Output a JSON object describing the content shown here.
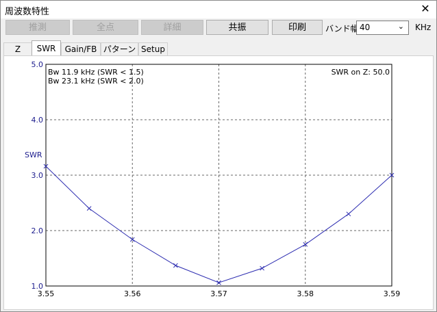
{
  "window": {
    "title": "周波数特性"
  },
  "toolbar": {
    "buttons": [
      {
        "label": "推測",
        "enabled": false
      },
      {
        "label": "全点",
        "enabled": false
      },
      {
        "label": "詳細",
        "enabled": false
      },
      {
        "label": "共振",
        "enabled": true
      },
      {
        "label": "印刷",
        "enabled": true
      }
    ],
    "band_label": "バンド幅",
    "band_value": "40",
    "unit_label": "KHz"
  },
  "tabs": [
    {
      "label": "Z",
      "active": false
    },
    {
      "label": "SWR",
      "active": true
    },
    {
      "label": "Gain/FB",
      "active": false
    },
    {
      "label": "パターン",
      "active": false
    },
    {
      "label": "Setup",
      "active": false
    }
  ],
  "chart_data": {
    "type": "line",
    "ylabel": "SWR",
    "xlabel": "",
    "xlim": [
      3.55,
      3.59
    ],
    "ylim": [
      1.0,
      5.0
    ],
    "x_ticks": [
      "3.55",
      "3.56",
      "3.57",
      "3.58",
      "3.59"
    ],
    "y_ticks": [
      "1.0",
      "2.0",
      "3.0",
      "4.0",
      "5.0"
    ],
    "grid": true,
    "annotations": {
      "bw1": "Bw 11.9 kHz (SWR < 1.5)",
      "bw2": "Bw 23.1 kHz (SWR < 2.0)",
      "swr_on_z": "SWR on Z: 50.0"
    },
    "series": [
      {
        "color": "#2b2bb0",
        "x": [
          3.55,
          3.555,
          3.56,
          3.565,
          3.57,
          3.575,
          3.58,
          3.585,
          3.59
        ],
        "y": [
          3.16,
          2.4,
          1.84,
          1.37,
          1.06,
          1.32,
          1.75,
          2.3,
          3.0
        ]
      }
    ]
  }
}
